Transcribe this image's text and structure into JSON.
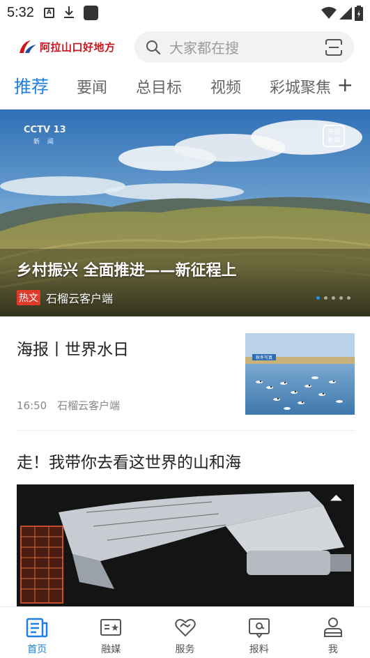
{
  "status_bar": {
    "time": "5:32",
    "notification_icons": [
      "a-icon",
      "download-icon",
      "square-icon"
    ],
    "right_icons": [
      "wifi-icon",
      "signal-icon",
      "battery-icon"
    ]
  },
  "header": {
    "logo_text": "阿拉山口好地方",
    "search_placeholder": "大家都在搜"
  },
  "tabs": [
    {
      "label": "推荐",
      "active": true
    },
    {
      "label": "要闻",
      "active": false
    },
    {
      "label": "总目标",
      "active": false
    },
    {
      "label": "视频",
      "active": false
    },
    {
      "label": "彩城聚焦",
      "active": false
    }
  ],
  "tabs_add_label": "+",
  "banner": {
    "channel_logo": "CCTV 13",
    "channel_sub": "新 闻",
    "corner_badge_top": "央视",
    "corner_badge_bottom": "新闻",
    "title": "乡村振兴 全面推进——新征程上",
    "tag": "热文",
    "source": "石榴云客户端",
    "slide_count": 5,
    "active_slide": 1
  },
  "articles": [
    {
      "title": "海报丨世界水日",
      "time": "16:50",
      "source": "石榴云客户端",
      "thumb_caption": "秋冬写真"
    },
    {
      "title": "走！我带你去看这世界的山和海"
    }
  ],
  "bottom_nav": [
    {
      "label": "首页",
      "icon": "home-news-icon",
      "active": true
    },
    {
      "label": "融媒",
      "icon": "media-icon",
      "active": false
    },
    {
      "label": "服务",
      "icon": "service-heart-icon",
      "active": false
    },
    {
      "label": "报料",
      "icon": "report-icon",
      "active": false
    },
    {
      "label": "我",
      "icon": "profile-icon",
      "active": false
    }
  ],
  "colors": {
    "accent": "#1f7fe3",
    "logo_red": "#d0121b",
    "hot_tag": "#e03a2b"
  }
}
